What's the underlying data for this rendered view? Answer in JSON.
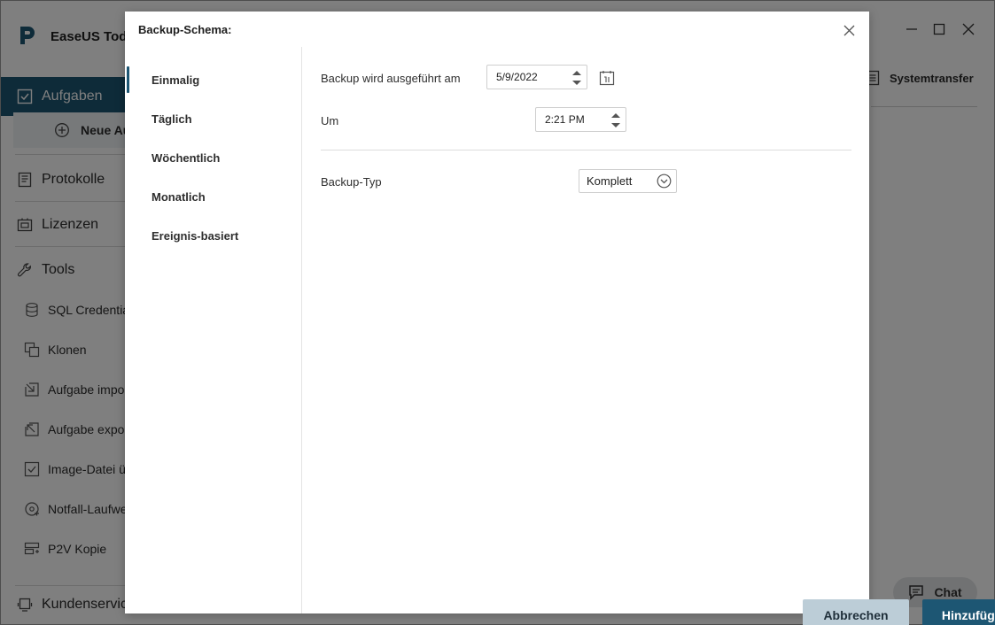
{
  "app": {
    "title": "EaseUS Todo",
    "sidebar": {
      "tasks_label": "Aufgaben",
      "new_task_label": "Neue Au",
      "logs_label": "Protokolle",
      "licenses_label": "Lizenzen",
      "tools_label": "Tools",
      "tools": [
        {
          "label": "SQL Credentia",
          "icon": "database-icon"
        },
        {
          "label": "Klonen",
          "icon": "clone-icon"
        },
        {
          "label": "Aufgabe impor",
          "icon": "import-icon"
        },
        {
          "label": "Aufgabe expor",
          "icon": "export-icon"
        },
        {
          "label": "Image-Datei ü",
          "icon": "check-image-icon"
        },
        {
          "label": "Notfall-Laufwe",
          "icon": "emergency-disk-icon"
        },
        {
          "label": "P2V Kopie",
          "icon": "p2v-icon"
        }
      ],
      "support_label": "Kundenservice"
    },
    "right_tab_label": "Systemtransfer",
    "chat_label": "Chat"
  },
  "dialog": {
    "title": "Backup-Schema:",
    "nav": [
      {
        "label": "Einmalig",
        "active": true
      },
      {
        "label": "Täglich",
        "active": false
      },
      {
        "label": "Wöchentlich",
        "active": false
      },
      {
        "label": "Monatlich",
        "active": false
      },
      {
        "label": "Ereignis-basiert",
        "active": false
      }
    ],
    "date_label": "Backup wird ausgeführt am",
    "date_value": "5/9/2022",
    "time_label": "Um",
    "time_value": "2:21 PM",
    "type_label": "Backup-Typ",
    "type_value": "Komplett",
    "cancel_label": "Abbrechen",
    "add_label": "Hinzufügen"
  },
  "colors": {
    "accent": "#1d5673",
    "cancel_bg": "#bccdd7"
  }
}
